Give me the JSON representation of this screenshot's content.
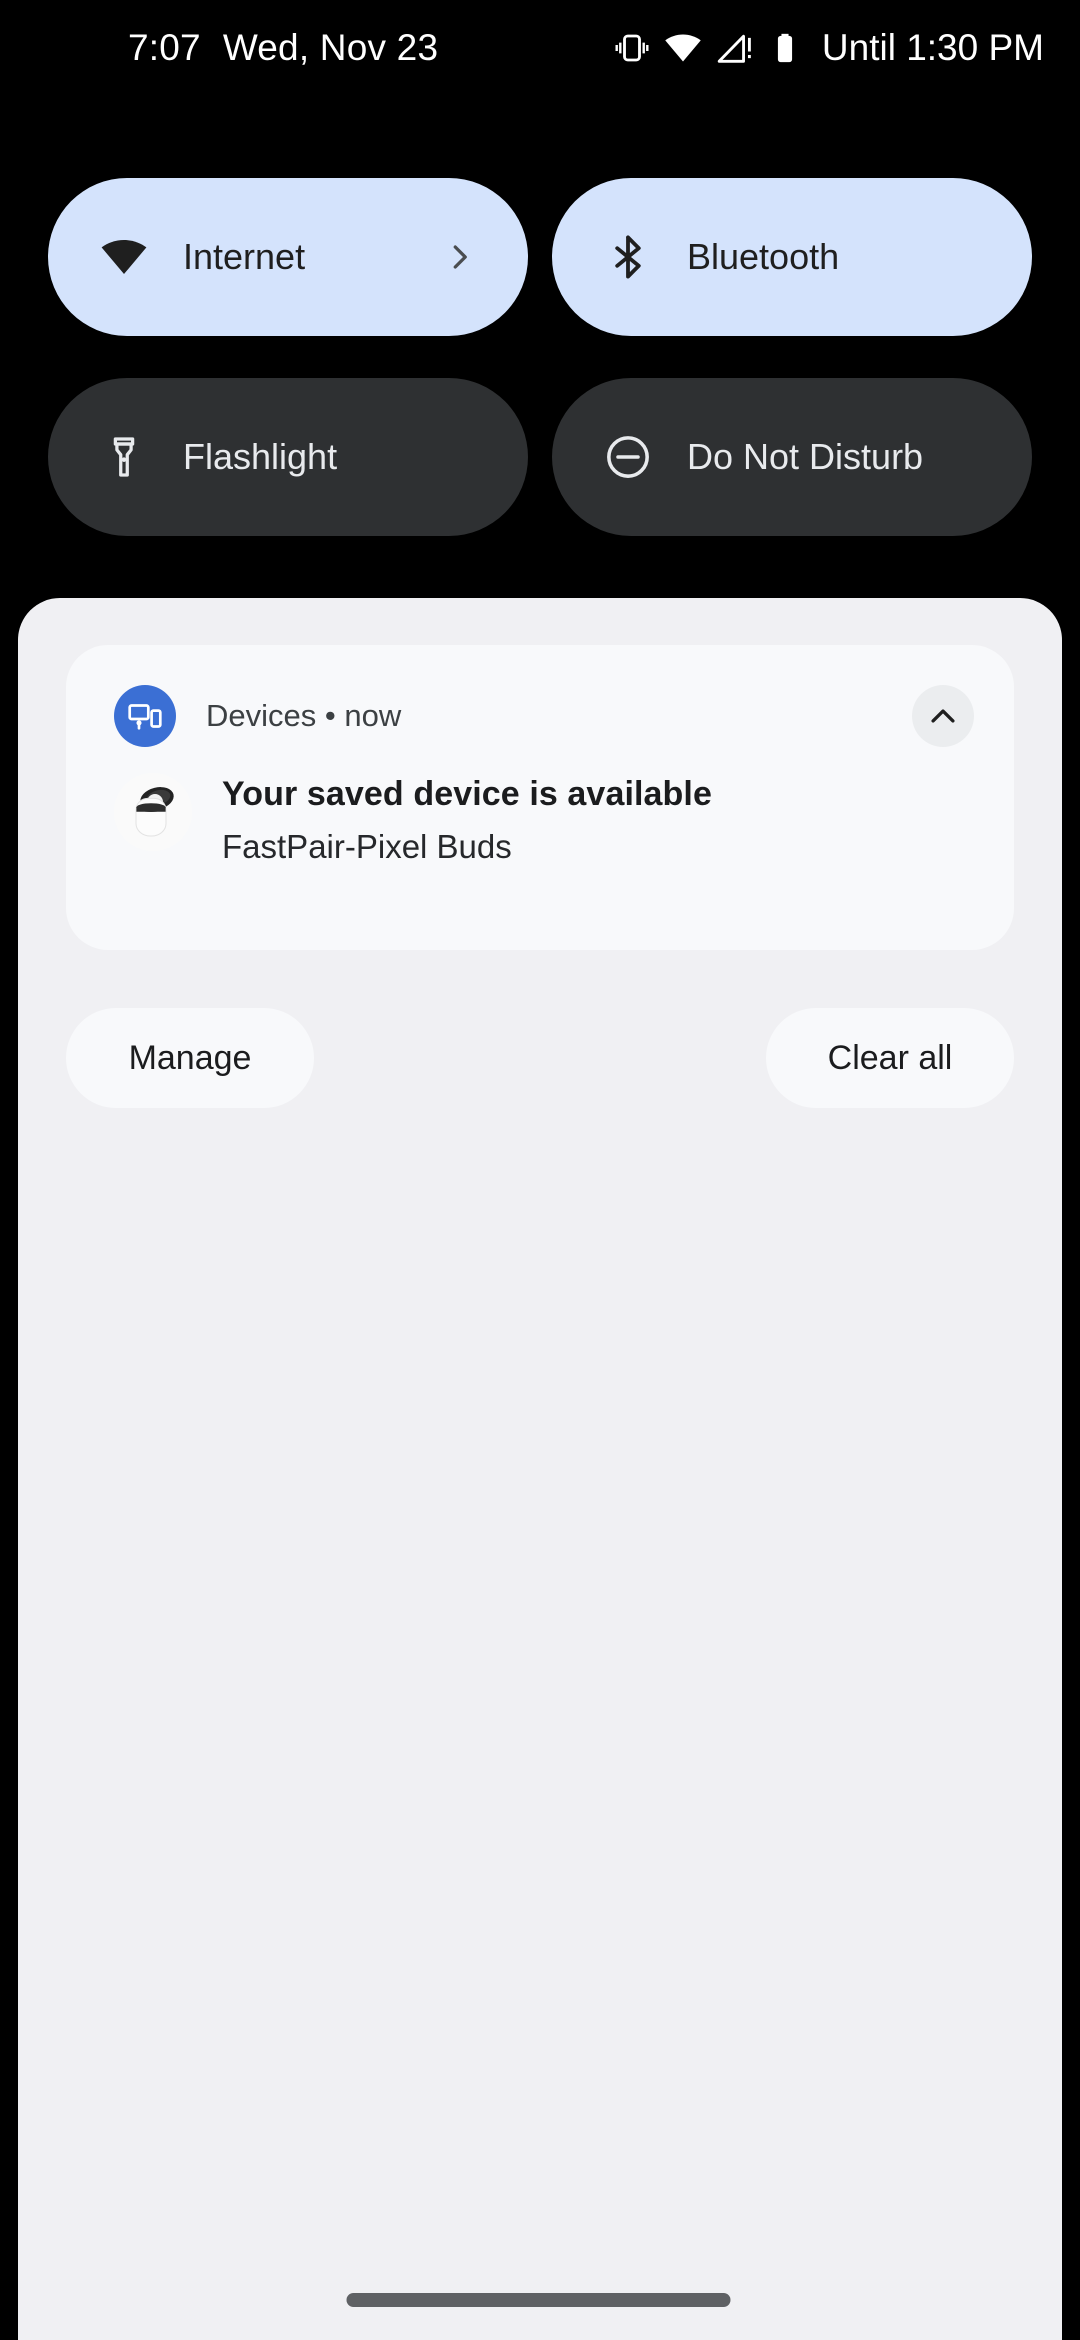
{
  "status_bar": {
    "time": "7:07",
    "date": "Wed, Nov 23",
    "battery_estimate": "Until 1:30 PM",
    "icons": [
      "vibrate-icon",
      "wifi-icon",
      "no-sim-signal-icon",
      "battery-icon"
    ]
  },
  "quick_settings": {
    "tiles": [
      {
        "id": "internet",
        "label": "Internet",
        "icon": "wifi-icon",
        "state": "active",
        "has_chevron": true,
        "bg": "#D4E3FC",
        "fg": "#1F1F1F"
      },
      {
        "id": "bluetooth",
        "label": "Bluetooth",
        "icon": "bluetooth-icon",
        "state": "active",
        "has_chevron": false,
        "bg": "#D4E3FC",
        "fg": "#1F1F1F"
      },
      {
        "id": "flashlight",
        "label": "Flashlight",
        "icon": "flashlight-icon",
        "state": "inactive",
        "has_chevron": false,
        "bg": "#2E3032",
        "fg": "#E8EAED"
      },
      {
        "id": "dnd",
        "label": "Do Not Disturb",
        "icon": "minus-circle-icon",
        "state": "inactive",
        "has_chevron": false,
        "bg": "#2E3032",
        "fg": "#E8EAED"
      }
    ]
  },
  "notification_shade": {
    "background": "#F0F0F3",
    "notification": {
      "app_name": "Devices",
      "separator": "•",
      "time": "now",
      "header_text": "Devices • now",
      "app_icon": "devices-icon",
      "app_icon_color": "#3B6FD4",
      "thumbnail": "pixel-buds-case-image",
      "title": "Your saved device is available",
      "subtitle": "FastPair-Pixel Buds",
      "expand_icon": "chevron-up-icon"
    },
    "footer": {
      "manage_label": "Manage",
      "clear_all_label": "Clear all"
    }
  },
  "navigation": {
    "gesture_bar": "home-gesture-bar"
  }
}
